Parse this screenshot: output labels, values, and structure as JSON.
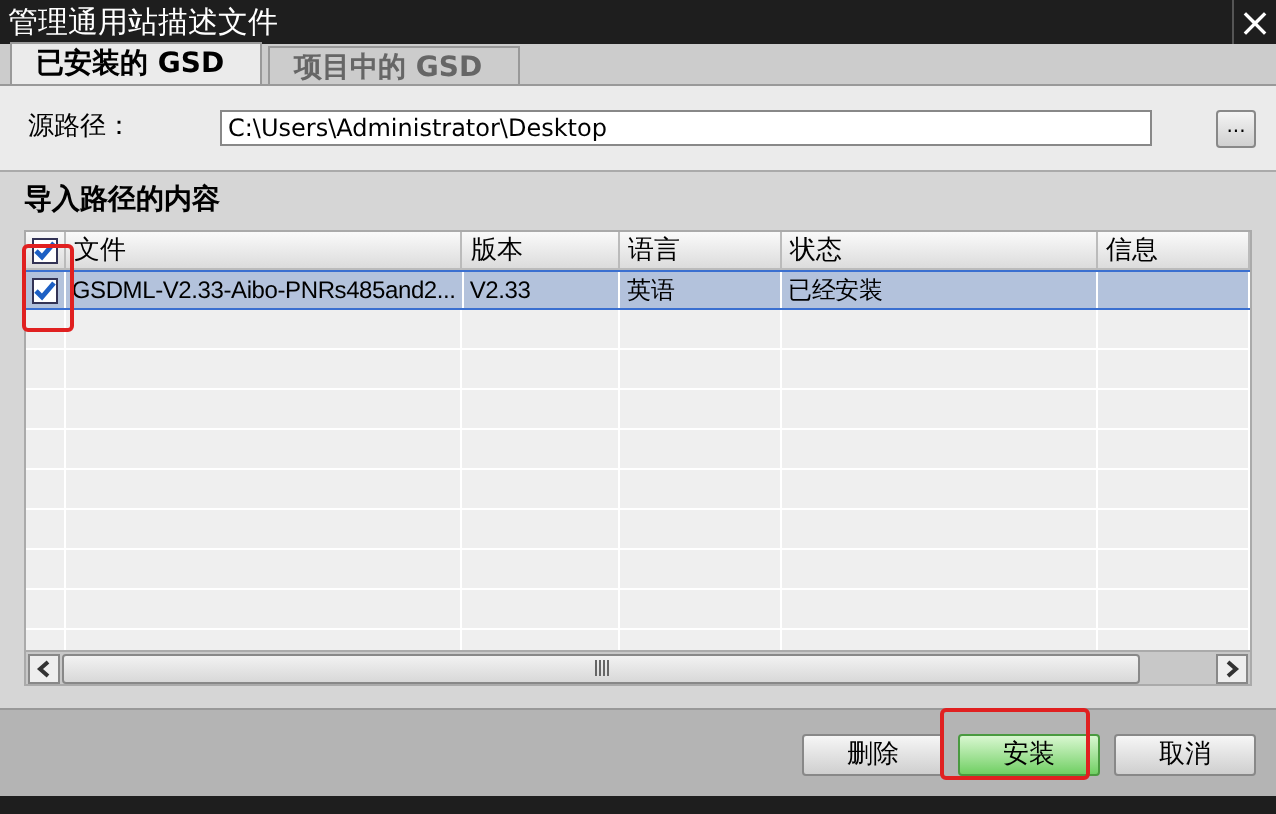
{
  "window": {
    "title": "管理通用站描述文件",
    "close": "×"
  },
  "tabs": [
    {
      "label": "已安装的 GSD",
      "selected": true
    },
    {
      "label": "项目中的 GSD",
      "selected": false
    }
  ],
  "source": {
    "label": "源路径：",
    "value": "C:\\Users\\Administrator\\Desktop",
    "browse": "..."
  },
  "section_title": "导入路径的内容",
  "table": {
    "header_checked": true,
    "columns": [
      "文件",
      "版本",
      "语言",
      "状态",
      "信息"
    ],
    "rows": [
      {
        "checked": true,
        "selected": true,
        "cells": [
          "GSDML-V2.33-Aibo-PNRs485and2...",
          "V2.33",
          "英语",
          "已经安装",
          ""
        ]
      }
    ]
  },
  "buttons": [
    {
      "label": "删除",
      "kind": "normal"
    },
    {
      "label": "安装",
      "kind": "primary"
    },
    {
      "label": "取消",
      "kind": "normal"
    }
  ]
}
